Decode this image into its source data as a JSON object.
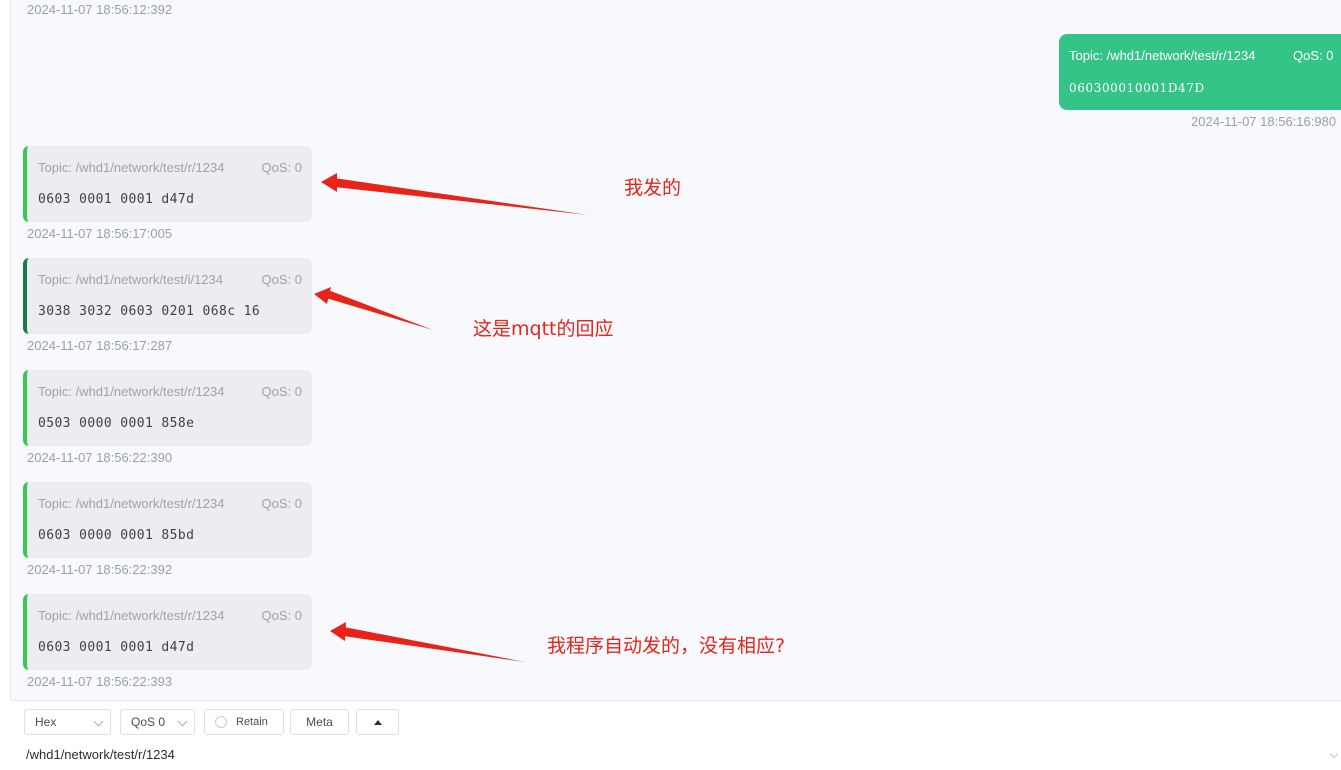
{
  "messages": [
    {
      "timestamp": "2024-11-07 18:56:12:392"
    },
    {
      "direction": "sent",
      "topic": "Topic: /whd1/network/test/r/1234",
      "qos": "QoS: 0",
      "payload": "060300010001D47D",
      "timestamp": "2024-11-07 18:56:16:980"
    },
    {
      "direction": "received",
      "topic": "Topic: /whd1/network/test/r/1234",
      "qos": "QoS: 0",
      "payload": "0603 0001 0001 d47d",
      "timestamp": "2024-11-07 18:56:17:005"
    },
    {
      "direction": "received",
      "topic": "Topic: /whd1/network/test/i/1234",
      "qos": "QoS: 0",
      "payload": "3038 3032 0603 0201 068c 16",
      "timestamp": "2024-11-07 18:56:17:287"
    },
    {
      "direction": "received",
      "topic": "Topic: /whd1/network/test/r/1234",
      "qos": "QoS: 0",
      "payload": "0503 0000 0001 858e",
      "timestamp": "2024-11-07 18:56:22:390"
    },
    {
      "direction": "received",
      "topic": "Topic: /whd1/network/test/r/1234",
      "qos": "QoS: 0",
      "payload": "0603 0000 0001 85bd",
      "timestamp": "2024-11-07 18:56:22:392"
    },
    {
      "direction": "received",
      "topic": "Topic: /whd1/network/test/r/1234",
      "qos": "QoS: 0",
      "payload": "0603 0001 0001 d47d",
      "timestamp": "2024-11-07 18:56:22:393"
    }
  ],
  "annotations": [
    "我发的",
    "这是mqtt的回应",
    "我程序自动发的，没有相应?"
  ],
  "composer": {
    "format": "Hex",
    "qos": "QoS 0",
    "retain_label": "Retain",
    "meta_label": "Meta",
    "topic_value": "/whd1/network/test/r/1234"
  },
  "colors": {
    "sent_bubble": "#35c487",
    "received_accent": "#34cb4f",
    "received_accent_alt": "#1a7a4c",
    "annotation": "#e8231a"
  },
  "icons": [
    "chevron-down-icon",
    "radio-circle-icon",
    "caret-up-icon",
    "arrow-annotation-icon"
  ]
}
